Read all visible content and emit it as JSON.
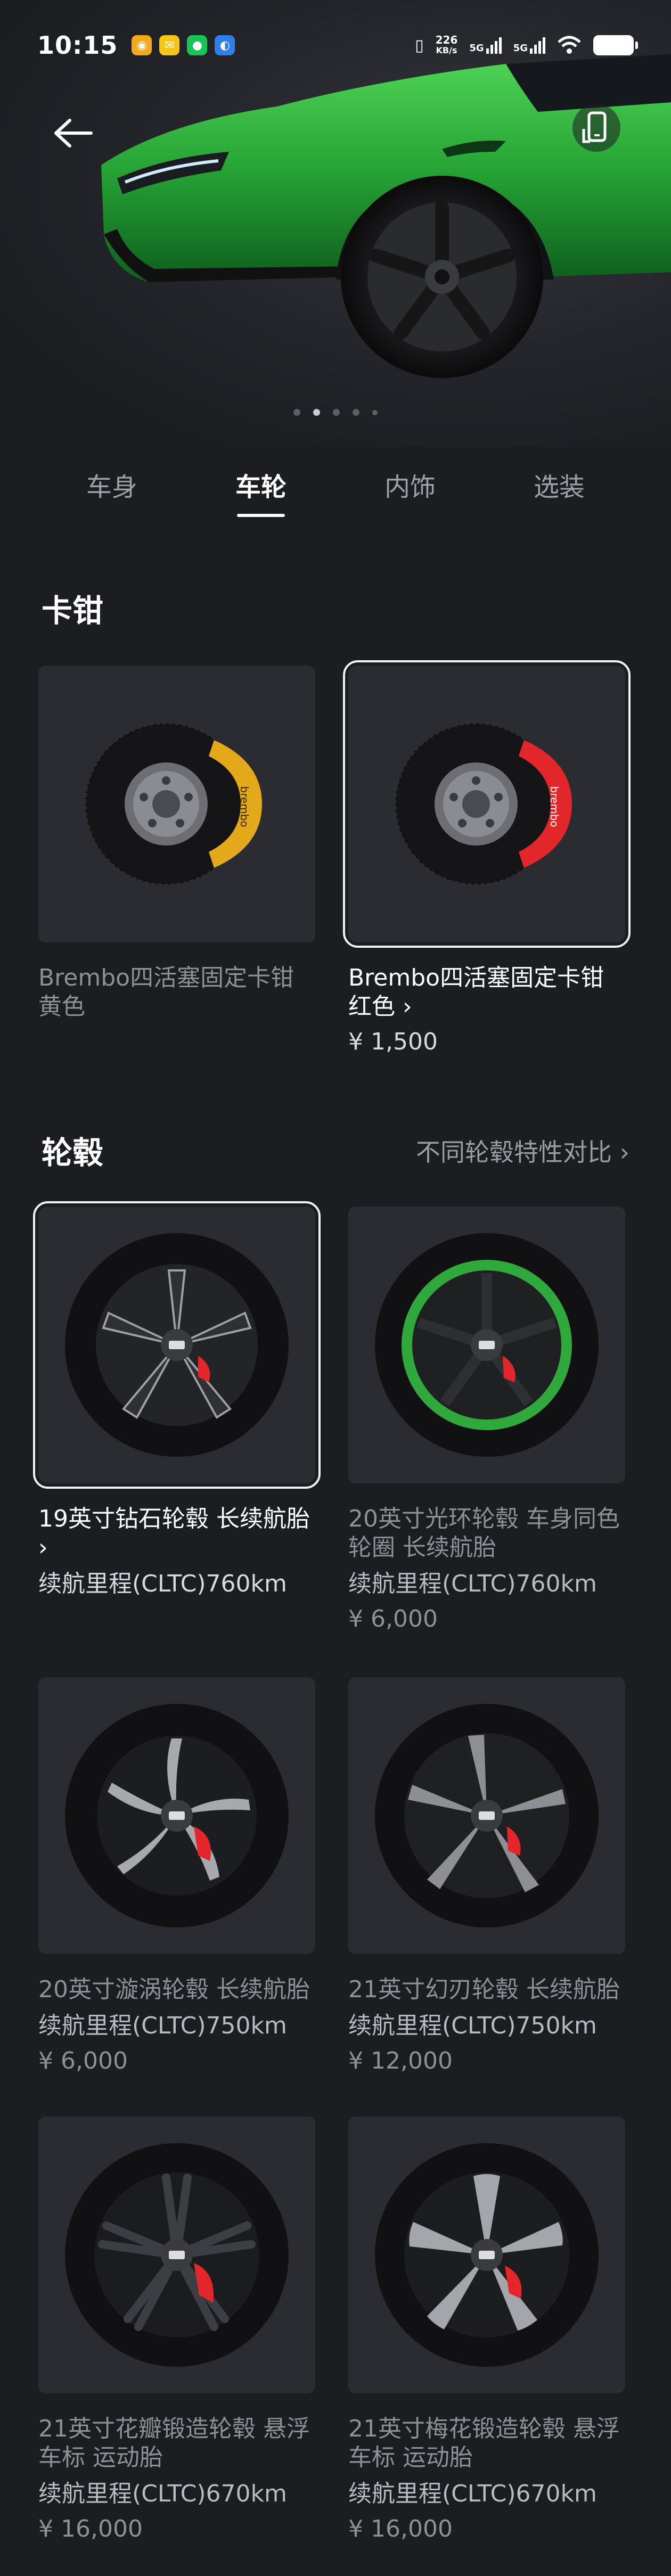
{
  "status_bar": {
    "time": "10:15",
    "speed_value": "226",
    "speed_unit": "KB/s",
    "signal_1": "5G",
    "signal_2": "5G",
    "notification_icons": [
      "weibo-icon",
      "email-icon",
      "wechat-icon",
      "browser-icon"
    ]
  },
  "hero": {
    "car_color": "#2fa83c",
    "carousel_total": 5,
    "carousel_active": 2
  },
  "tabs": [
    {
      "label": "车身",
      "active": false
    },
    {
      "label": "车轮",
      "active": true
    },
    {
      "label": "内饰",
      "active": false
    },
    {
      "label": "选装",
      "active": false
    }
  ],
  "calipers": {
    "title": "卡钳",
    "items": [
      {
        "name": "Brembo四活塞固定卡钳\n黄色",
        "price": "",
        "color": "#e3a91a",
        "selected": false
      },
      {
        "name": "Brembo四活塞固定卡钳\n红色 ›",
        "price": "¥ 1,500",
        "color": "#e3262a",
        "selected": true
      }
    ]
  },
  "wheels": {
    "title": "轮毂",
    "compare_link": "不同轮毂特性对比 ›",
    "items": [
      {
        "name": "19英寸钻石轮毂 长续航胎\n›",
        "range": "续航里程(CLTC)760km",
        "price": "",
        "selected": true
      },
      {
        "name": "20英寸光环轮毂 车身同色\n轮圈 长续航胎",
        "range": "续航里程(CLTC)760km",
        "price": "¥ 6,000",
        "selected": false
      },
      {
        "name": "20英寸漩涡轮毂 长续航胎",
        "range": "续航里程(CLTC)750km",
        "price": "¥ 6,000",
        "selected": false
      },
      {
        "name": "21英寸幻刃轮毂 长续航胎",
        "range": "续航里程(CLTC)750km",
        "price": "¥ 12,000",
        "selected": false
      },
      {
        "name": "21英寸花瓣锻造轮毂 悬浮\n车标 运动胎",
        "range": "续航里程(CLTC)670km",
        "price": "¥ 16,000",
        "selected": false
      },
      {
        "name": "21英寸梅花锻造轮毂 悬浮\n车标 运动胎",
        "range": "续航里程(CLTC)670km",
        "price": "¥ 16,000",
        "selected": false
      }
    ]
  },
  "colors": {
    "background": "#1c1d21",
    "card": "#2b2c31",
    "caliper_red": "#e3262a",
    "caliper_yellow": "#e3a91a",
    "ring_green": "#2fa83c"
  }
}
